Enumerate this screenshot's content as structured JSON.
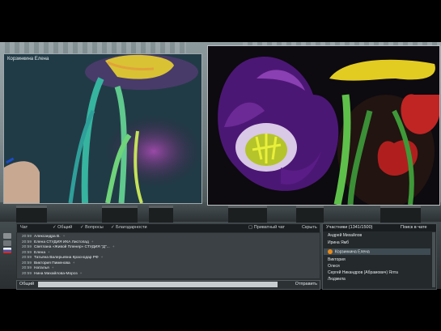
{
  "presenter": {
    "name": "Корзинкина Елена"
  },
  "chat": {
    "title": "Чат",
    "filters": [
      "Общий",
      "Вопросы",
      "Благодарности"
    ],
    "private_label": "Приватный чат",
    "close_label": "Скрыть",
    "messages": [
      {
        "time": "20:59",
        "name": "Александра В.",
        "mark": "+"
      },
      {
        "time": "20:59",
        "name": "Елена СТУДИЯ ИКА Листопад",
        "mark": "+"
      },
      {
        "time": "20:59",
        "name": "Светлана «Живой Пленер» СТУДИЯ \"Д\"...",
        "mark": "+"
      },
      {
        "time": "20:59",
        "name": "Елена",
        "mark": "+"
      },
      {
        "time": "20:59",
        "name": "Татьяна Валерьевна Краснодар РФ",
        "mark": "+"
      },
      {
        "time": "20:59",
        "name": "Виктория Пименова",
        "mark": "+"
      },
      {
        "time": "20:59",
        "name": "Наталья",
        "mark": "+"
      },
      {
        "time": "20:59",
        "name": "Нина Михайлова-Мороз",
        "mark": "+"
      }
    ]
  },
  "input": {
    "label": "Общий",
    "send": "Отправить"
  },
  "participants": {
    "title": "Участники (1341/1500)",
    "action": "Поиск в чате",
    "rows": [
      {
        "name": "Андрей Михайлов",
        "host": false
      },
      {
        "name": "Ирина Ямб",
        "host": false
      },
      {
        "name": "Корзинкина Елена",
        "host": true
      },
      {
        "name": "Виктория",
        "host": false
      },
      {
        "name": "Олеся",
        "host": false
      },
      {
        "name": "Сергей Никандров (Абрамович) Ялта",
        "host": false
      },
      {
        "name": "Людмила",
        "host": false
      }
    ]
  },
  "colors": {
    "accent": "#e88a1a",
    "flag_top": "#ffffff",
    "flag_mid": "#2a5cc7",
    "flag_bot": "#d52a2a"
  }
}
